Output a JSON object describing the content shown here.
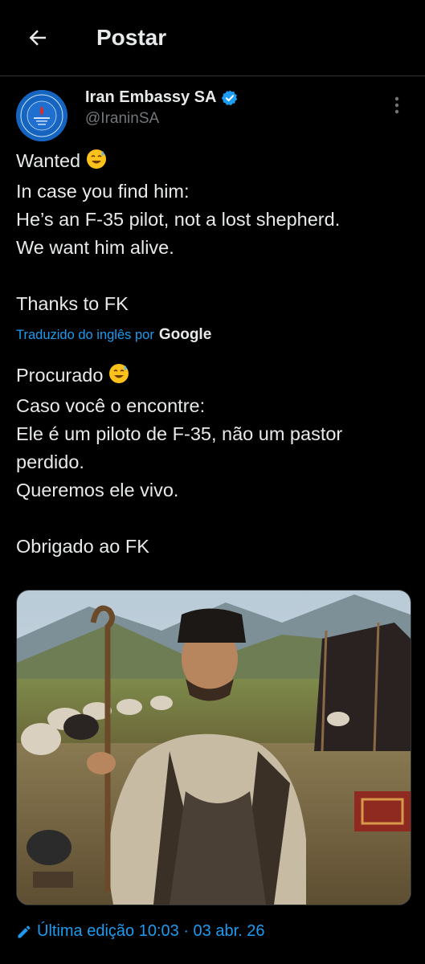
{
  "header": {
    "title": "Postar",
    "back_icon": "arrow-left-icon"
  },
  "author": {
    "name": "Iran Embassy SA",
    "handle": "@IraninSA",
    "verified_icon": "verified-badge-icon",
    "verified_color": "#1d9bf0"
  },
  "tweet": {
    "original": {
      "line1": "Wanted",
      "emoji1": "😅",
      "rest": "In case you find him:\nHe’s an F-35 pilot, not a lost shepherd.\nWe want him alive.\n\nThanks to FK"
    },
    "translation_label": "Traduzido do inglês por",
    "translation_brand": "Google",
    "translated": {
      "line1": "Procurado",
      "emoji1": "😅",
      "rest": "Caso você o encontre:\nEle é um piloto de F-35, não um pastor\nperdido.\nQueremos ele vivo.\n\nObrigado ao FK"
    },
    "edit_label": "Última edição 10:03 · 03 abr. 26"
  },
  "colors": {
    "accent": "#1d9bf0",
    "background": "#000000",
    "text": "#e7e9ea",
    "muted": "#71767b"
  }
}
